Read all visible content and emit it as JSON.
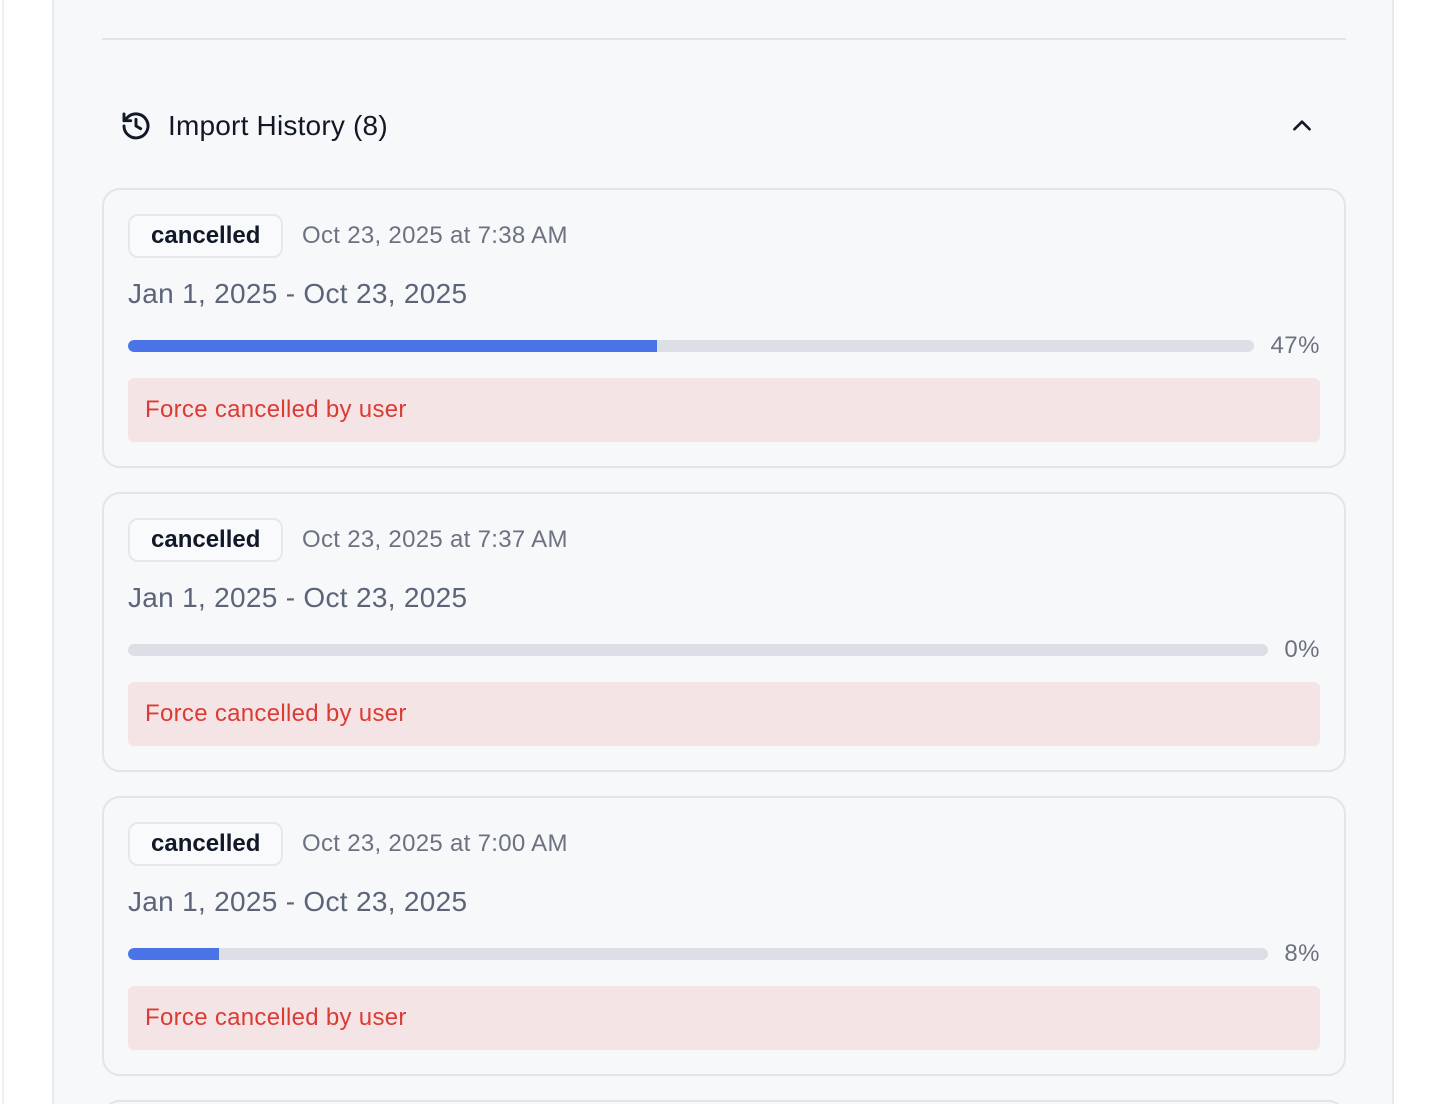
{
  "section": {
    "title": "Import History (8)",
    "icon": "history-icon",
    "toggle_icon": "chevron-up-icon"
  },
  "imports": [
    {
      "status": "cancelled",
      "timestamp": "Oct 23, 2025 at 7:38 AM",
      "date_range": "Jan 1, 2025 - Oct 23, 2025",
      "progress": 47,
      "progress_label": "47%",
      "message": "Force cancelled by user"
    },
    {
      "status": "cancelled",
      "timestamp": "Oct 23, 2025 at 7:37 AM",
      "date_range": "Jan 1, 2025 - Oct 23, 2025",
      "progress": 0,
      "progress_label": "0%",
      "message": "Force cancelled by user"
    },
    {
      "status": "cancelled",
      "timestamp": "Oct 23, 2025 at 7:00 AM",
      "date_range": "Jan 1, 2025 - Oct 23, 2025",
      "progress": 8,
      "progress_label": "8%",
      "message": "Force cancelled by user"
    }
  ],
  "colors": {
    "accent": "#4a73e8",
    "error_text": "#dc3b34",
    "error_bg": "#f5e4e6"
  }
}
